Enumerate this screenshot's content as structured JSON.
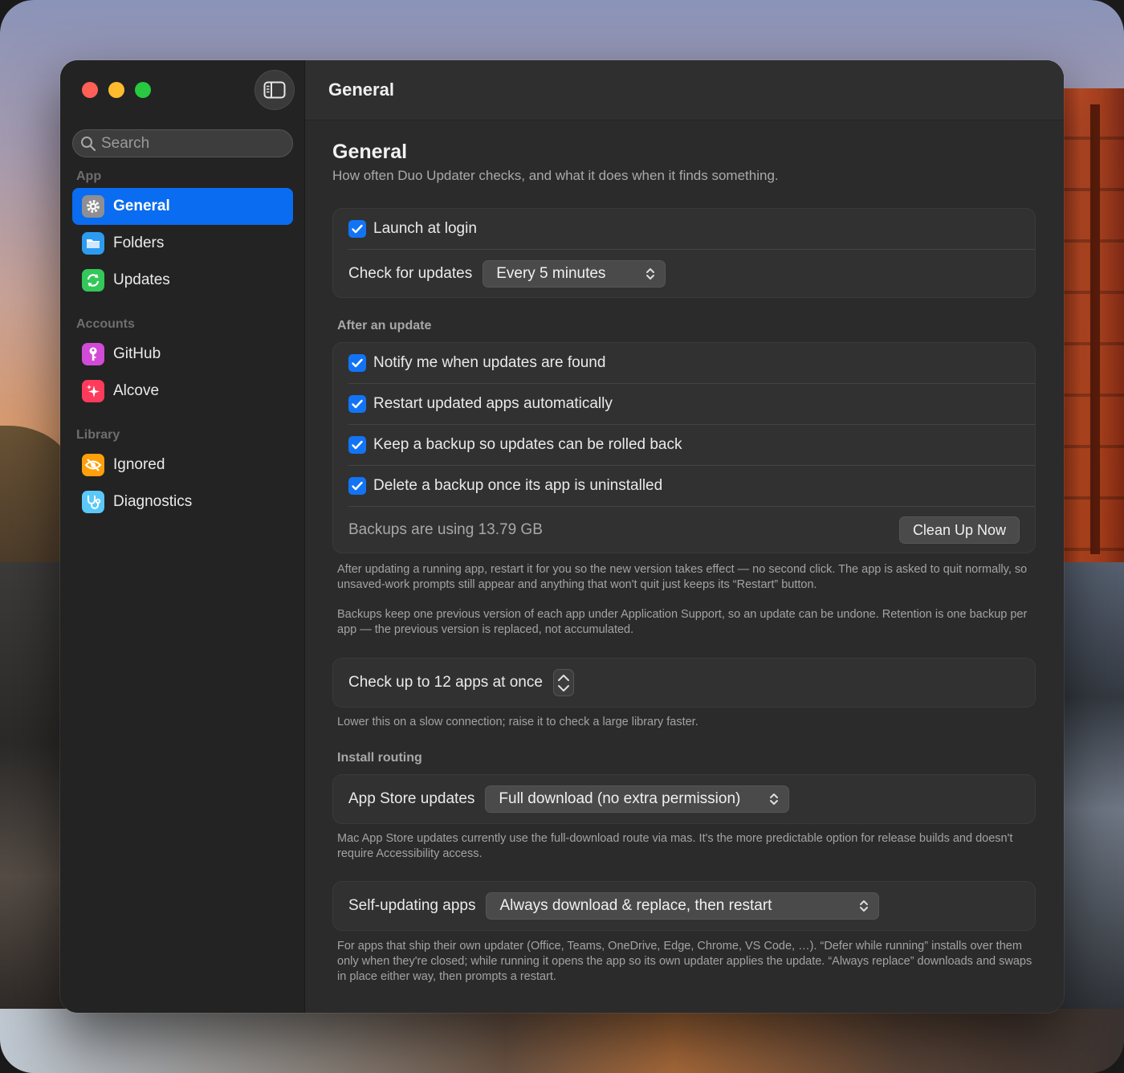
{
  "window": {
    "title": "General"
  },
  "search": {
    "placeholder": "Search"
  },
  "sidebar": {
    "sections": [
      {
        "label": "App"
      },
      {
        "label": "Accounts"
      },
      {
        "label": "Library"
      }
    ],
    "items": [
      {
        "label": "General",
        "icon": "gear-icon",
        "color": "#8e8e93",
        "active": true
      },
      {
        "label": "Folders",
        "icon": "folder-icon",
        "color": "#2d9bf0"
      },
      {
        "label": "Updates",
        "icon": "refresh-icon",
        "color": "#34c759"
      },
      {
        "label": "GitHub",
        "icon": "key-icon",
        "color": "#d14bd7"
      },
      {
        "label": "Alcove",
        "icon": "sparkle-icon",
        "color": "#ff3b5c"
      },
      {
        "label": "Ignored",
        "icon": "eye-slash-icon",
        "color": "#ff9f0a"
      },
      {
        "label": "Diagnostics",
        "icon": "stethoscope-icon",
        "color": "#5ac8fa"
      }
    ]
  },
  "page": {
    "title": "General",
    "subtitle": "How often Duo Updater checks, and what it does when it finds something."
  },
  "general_group": {
    "launch_at_login": {
      "label": "Launch at login",
      "checked": true
    },
    "check_for_updates": {
      "label": "Check for updates",
      "value": "Every 5 minutes"
    }
  },
  "after_update": {
    "header": "After an update",
    "options": [
      {
        "label": "Notify me when updates are found",
        "checked": true
      },
      {
        "label": "Restart updated apps automatically",
        "checked": true
      },
      {
        "label": "Keep a backup so updates can be rolled back",
        "checked": true
      },
      {
        "label": "Delete a backup once its app is uninstalled",
        "checked": true
      }
    ],
    "backup_usage": "Backups are using 13.79 GB",
    "cleanup_button": "Clean Up Now",
    "note_restart": "After updating a running app, restart it for you so the new version takes effect — no second click. The app is asked to quit normally, so unsaved-work prompts still appear and anything that won't quit just keeps its “Restart” button.",
    "note_backups": "Backups keep one previous version of each app under Application Support, so an update can be undone. Retention is one backup per app — the previous version is replaced, not accumulated."
  },
  "concurrency": {
    "label": "Check up to 12 apps at once",
    "value": 12,
    "note": "Lower this on a slow connection; raise it to check a large library faster."
  },
  "install_routing": {
    "header": "Install routing",
    "app_store": {
      "label": "App Store updates",
      "value": "Full download (no extra permission)"
    },
    "app_store_note": "Mac App Store updates currently use the full-download route via mas. It's the more predictable option for release builds and doesn't require Accessibility access.",
    "self_updating": {
      "label": "Self-updating apps",
      "value": "Always download & replace, then restart"
    },
    "self_updating_note": "For apps that ship their own updater (Office, Teams, OneDrive, Edge, Chrome, VS Code, …). “Defer while running” installs over them only when they're closed; while running it opens the app so its own updater applies the update. “Always replace” downloads and swaps in place either way, then prompts a restart."
  },
  "colors": {
    "accent": "#0a6cf0",
    "checkbox": "#1274f5",
    "window_bg": "#2b2b2b",
    "sidebar_bg": "#232323"
  }
}
